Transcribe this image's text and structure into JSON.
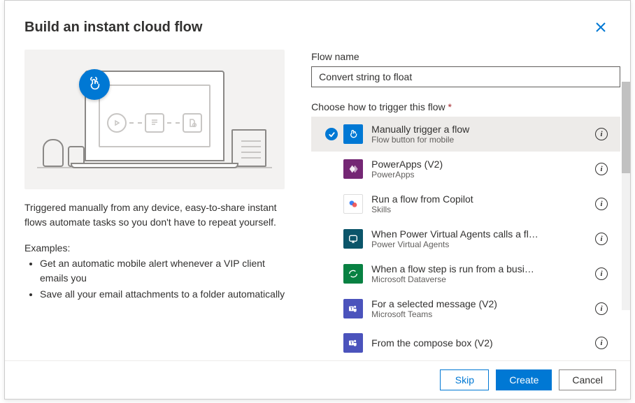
{
  "header": {
    "title": "Build an instant cloud flow"
  },
  "left": {
    "description": "Triggered manually from any device, easy-to-share instant flows automate tasks so you don't have to repeat yourself.",
    "examples_label": "Examples:",
    "examples": [
      "Get an automatic mobile alert whenever a VIP client emails you",
      "Save all your email attachments to a folder automatically"
    ]
  },
  "right": {
    "flow_name_label": "Flow name",
    "flow_name_value": "Convert string to float",
    "choose_label": "Choose how to trigger this flow",
    "triggers": [
      {
        "title": "Manually trigger a flow",
        "subtitle": "Flow button for mobile",
        "color": "#0078d4",
        "icon": "hand",
        "selected": true
      },
      {
        "title": "PowerApps (V2)",
        "subtitle": "PowerApps",
        "color": "#742774",
        "icon": "powerapps",
        "selected": false
      },
      {
        "title": "Run a flow from Copilot",
        "subtitle": "Skills",
        "color": "#ffffff",
        "icon": "copilot",
        "selected": false
      },
      {
        "title": "When Power Virtual Agents calls a fl…",
        "subtitle": "Power Virtual Agents",
        "color": "#0b556a",
        "icon": "pva",
        "selected": false
      },
      {
        "title": "When a flow step is run from a busi…",
        "subtitle": "Microsoft Dataverse",
        "color": "#088142",
        "icon": "dataverse",
        "selected": false
      },
      {
        "title": "For a selected message (V2)",
        "subtitle": "Microsoft Teams",
        "color": "#4b53bc",
        "icon": "teams",
        "selected": false
      },
      {
        "title": "From the compose box (V2)",
        "subtitle": "",
        "color": "#4b53bc",
        "icon": "teams",
        "selected": false
      }
    ]
  },
  "footer": {
    "skip": "Skip",
    "create": "Create",
    "cancel": "Cancel"
  }
}
